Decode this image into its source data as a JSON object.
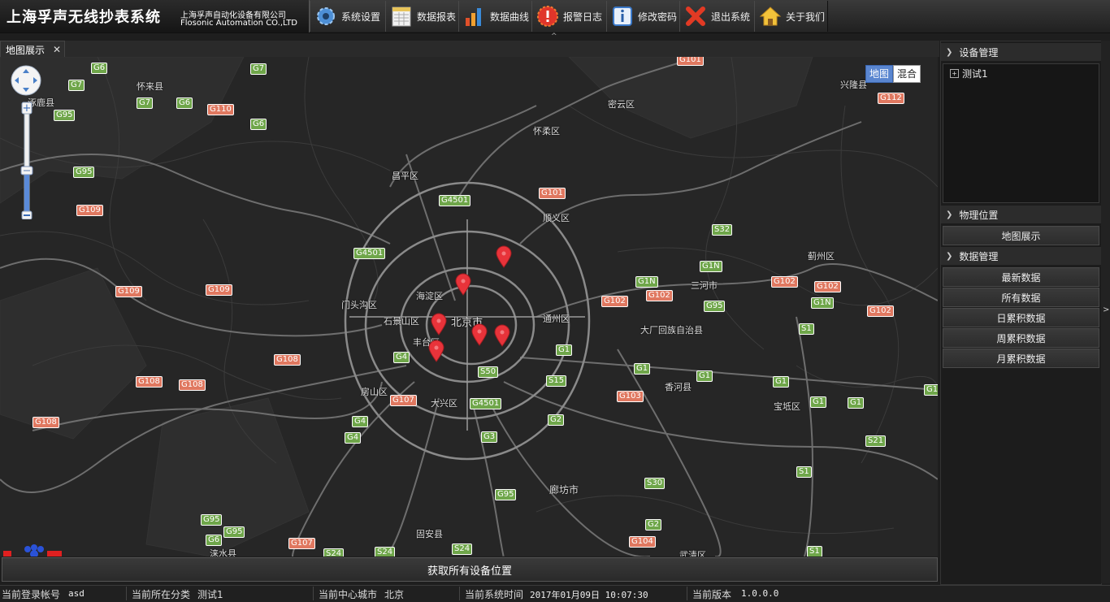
{
  "app": {
    "title": "上海孚声无线抄表系统",
    "company_cn": "上海孚声自动化设备有限公司",
    "company_en": "Flosonic Automation CO.,LTD"
  },
  "toolbar": {
    "items": [
      {
        "label": "系统设置",
        "icon": "gear-icon"
      },
      {
        "label": "数据报表",
        "icon": "report-icon"
      },
      {
        "label": "数据曲线",
        "icon": "chart-icon"
      },
      {
        "label": "报警日志",
        "icon": "alarm-icon"
      },
      {
        "label": "修改密码",
        "icon": "info-icon"
      },
      {
        "label": "退出系统",
        "icon": "exit-icon"
      },
      {
        "label": "关于我们",
        "icon": "home-icon"
      }
    ]
  },
  "tabs": [
    {
      "label": "地图展示",
      "close": "✕"
    }
  ],
  "map": {
    "type_buttons": {
      "map": "地图",
      "hybrid": "混合"
    },
    "places": [
      "怀来县",
      "涿鹿县",
      "密云区",
      "怀柔区",
      "昌平区",
      "顺义区",
      "海淀区",
      "北京市",
      "门头沟区",
      "石景山区",
      "丰台区",
      "通州区",
      "三河市",
      "蓟州区",
      "兴隆县",
      "大厂回族自治县",
      "香河县",
      "房山区",
      "大兴区",
      "宝坻区",
      "廊坊市",
      "固安县",
      "涞水县",
      "武清区"
    ],
    "highway_labels": [
      "G6",
      "G7",
      "G95",
      "G110",
      "G109",
      "G108",
      "G4501",
      "G101",
      "G1N",
      "G102",
      "G112",
      "S32",
      "G1",
      "S1",
      "G103",
      "G4",
      "S50",
      "S15",
      "G2",
      "G3",
      "S30",
      "G104",
      "S21",
      "G107",
      "S24"
    ],
    "marker_color": "#e8333a"
  },
  "bottom_button": "获取所有设备位置",
  "right_panel": {
    "device_section": {
      "title": "设备管理",
      "tree_root": "测试1",
      "expander": "+"
    },
    "location_section": {
      "title": "物理位置",
      "buttons": [
        "地图展示"
      ]
    },
    "data_section": {
      "title": "数据管理",
      "buttons": [
        "最新数据",
        "所有数据",
        "日累积数据",
        "周累积数据",
        "月累积数据"
      ]
    }
  },
  "statusbar": {
    "account_label": "当前登录帐号",
    "account_value": "asd",
    "category_label": "当前所在分类",
    "category_value": "测试1",
    "city_label": "当前中心城市",
    "city_value": "北京",
    "time_label": "当前系统时间",
    "time_value": "2017年01月09日  10:07:30",
    "version_label": "当前版本",
    "version_value": "1.0.0.0"
  }
}
